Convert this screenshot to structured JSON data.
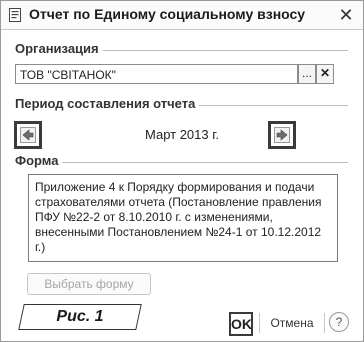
{
  "window": {
    "title": "Отчет по Единому социальному взносу",
    "close_glyph": "✕"
  },
  "organization": {
    "label": "Организация",
    "value": "ТОВ \"СВІТАНОК\"",
    "select_glyph": "...",
    "clear_glyph": "✕"
  },
  "period": {
    "label": "Период составления отчета",
    "value": "Март 2013 г."
  },
  "form": {
    "label": "Форма",
    "description": "Приложение 4 к Порядку формирования и подачи страхователями отчета (Постановление правления ПФУ №22-2 от 8.10.2010 г. с изменениями, внесенными Постановлением №24-1 от 10.12.2012 г.)",
    "select_button": "Выбрать форму"
  },
  "caption": "Рис. 1",
  "footer": {
    "ok_label": "OK",
    "cancel_label": "Отмена",
    "help_label": "?"
  },
  "icons": {
    "title": "document-icon",
    "prev": "arrow-left-icon",
    "next": "arrow-right-icon"
  },
  "colors": {
    "accent": "#3a3a3a",
    "disabled_text": "#a6a6a6"
  }
}
